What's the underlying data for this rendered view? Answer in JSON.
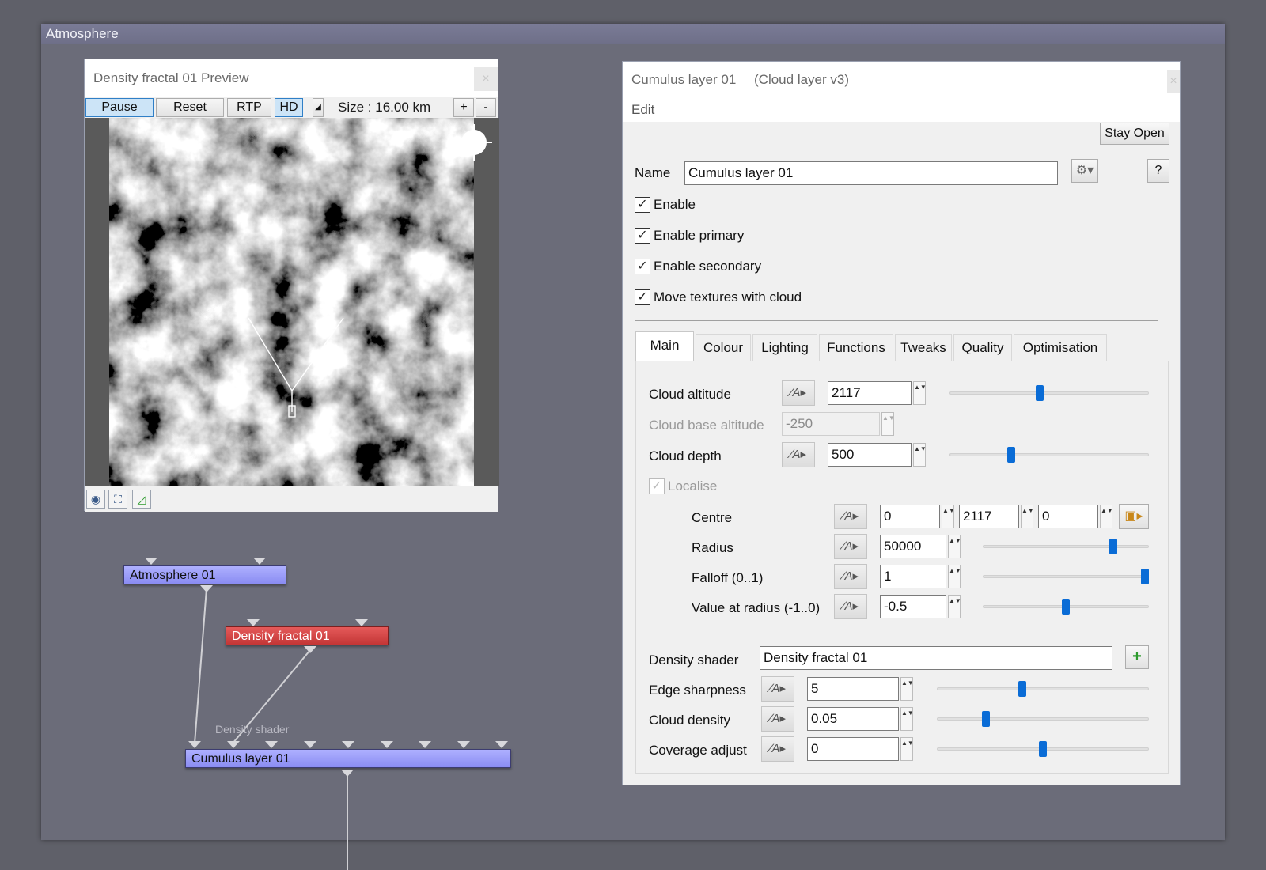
{
  "group": {
    "title": "Atmosphere"
  },
  "preview": {
    "title": "Density fractal 01 Preview",
    "close_glyph": "×",
    "toolbar": {
      "pause": "Pause",
      "reset": "Reset",
      "rtp": "RTP",
      "hd": "HD",
      "size_label": "Size : 16.00 km",
      "plus": "+",
      "minus": "-"
    }
  },
  "node_graph": {
    "nodes": [
      {
        "label": "Atmosphere 01",
        "color": "#9c9ef8"
      },
      {
        "label": "Density fractal 01",
        "color": "#d64545"
      },
      {
        "label": "Cumulus layer 01",
        "color": "#9c9ef8"
      }
    ],
    "connection_label": "Density shader"
  },
  "props": {
    "title": "Cumulus layer 01",
    "subtitle": "(Cloud layer v3)",
    "close_glyph": "×",
    "menu": [
      "Edit"
    ],
    "stay_open": "Stay Open",
    "name_label": "Name",
    "name_value": "Cumulus layer 01",
    "help": "?",
    "checkboxes": [
      {
        "label": "Enable",
        "checked": true
      },
      {
        "label": "Enable primary",
        "checked": true
      },
      {
        "label": "Enable secondary",
        "checked": true
      },
      {
        "label": "Move textures with cloud",
        "checked": true
      }
    ],
    "tabs": [
      "Main",
      "Colour",
      "Lighting",
      "Functions",
      "Tweaks",
      "Quality",
      "Optimisation"
    ],
    "active_tab": "Main",
    "fields": {
      "cloud_altitude": {
        "label": "Cloud altitude",
        "value": "2117",
        "slider": 0.45
      },
      "cloud_base_altitude": {
        "label": "Cloud base altitude",
        "value": "-250"
      },
      "cloud_depth": {
        "label": "Cloud depth",
        "value": "500",
        "slider": 0.3
      },
      "localise": {
        "label": "Localise",
        "checked": true
      },
      "centre": {
        "label": "Centre",
        "x": "0",
        "y": "2117",
        "z": "0"
      },
      "radius": {
        "label": "Radius",
        "value": "50000",
        "slider": 0.8
      },
      "falloff": {
        "label": "Falloff (0..1)",
        "value": "1",
        "slider": 1.0
      },
      "value_at_radius": {
        "label": "Value at radius (-1..0)",
        "value": "-0.5",
        "slider": 0.5
      },
      "density_shader": {
        "label": "Density shader",
        "value": "Density fractal 01"
      },
      "edge_sharpness": {
        "label": "Edge sharpness",
        "value": "5",
        "slider": 0.4
      },
      "cloud_density": {
        "label": "Cloud density",
        "value": "0.05",
        "slider": 0.22
      },
      "coverage_adjust": {
        "label": "Coverage adjust",
        "value": "0",
        "slider": 0.5
      }
    },
    "fn_glyph": "∕A▸",
    "spin_glyph": "▲▼"
  },
  "colors": {
    "accent": "#0a6cd6",
    "node_blue": "#9c9ef8",
    "node_red": "#d64545",
    "canvas": "#5f6069"
  }
}
